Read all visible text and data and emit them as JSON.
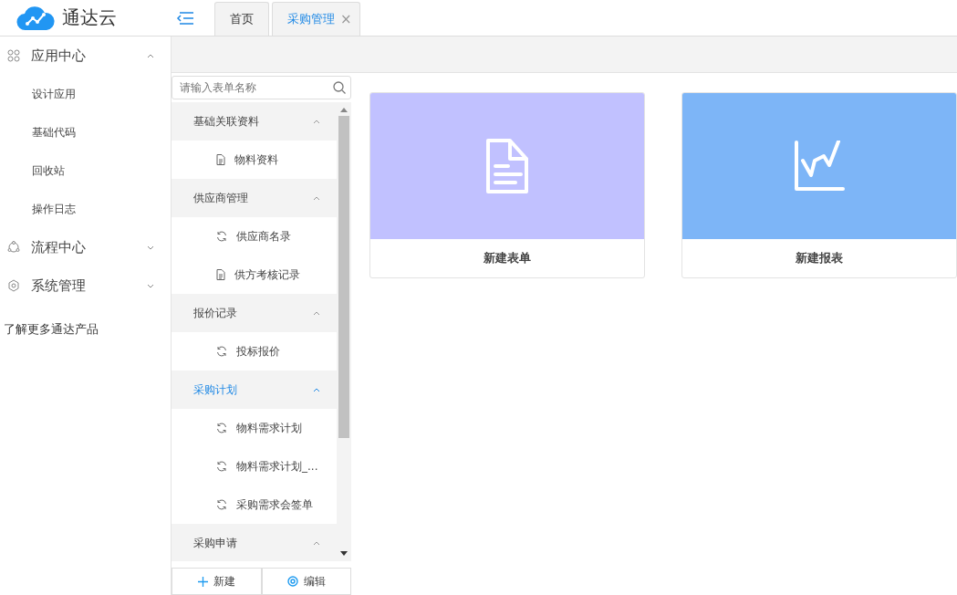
{
  "logo": {
    "text": "通达云"
  },
  "tabs": [
    {
      "label": "首页",
      "selected": false
    },
    {
      "label": "采购管理",
      "selected": true,
      "close": "×"
    }
  ],
  "sidebar": {
    "items": [
      {
        "label": "应用中心",
        "kind": "apps",
        "expanded": true,
        "children": [
          {
            "label": "设计应用"
          },
          {
            "label": "基础代码"
          },
          {
            "label": "回收站"
          },
          {
            "label": "操作日志"
          }
        ]
      },
      {
        "label": "流程中心",
        "kind": "flow",
        "expanded": false
      },
      {
        "label": "系统管理",
        "kind": "gear",
        "expanded": false
      }
    ],
    "footer_link": "了解更多通达产品"
  },
  "form_list": {
    "search": {
      "placeholder": "请输入表单名称"
    },
    "groups": [
      {
        "label": "基础关联资料",
        "expanded": true,
        "selected": false,
        "children": [
          {
            "label": "物料资料",
            "kind": "form"
          }
        ]
      },
      {
        "label": "供应商管理",
        "expanded": true,
        "selected": false,
        "children": [
          {
            "label": "供应商名录",
            "kind": "flow"
          },
          {
            "label": "供方考核记录",
            "kind": "form"
          }
        ]
      },
      {
        "label": "报价记录",
        "expanded": true,
        "selected": false,
        "children": [
          {
            "label": "投标报价",
            "kind": "flow"
          }
        ]
      },
      {
        "label": "采购计划",
        "expanded": true,
        "selected": true,
        "children": [
          {
            "label": "物料需求计划",
            "kind": "flow"
          },
          {
            "label": "物料需求计划_...",
            "kind": "flow"
          },
          {
            "label": "采购需求会签单",
            "kind": "flow"
          }
        ]
      },
      {
        "label": "采购申请",
        "expanded": true,
        "selected": false
      }
    ],
    "buttons": [
      {
        "label": "新建",
        "kind": "add"
      },
      {
        "label": "编辑",
        "kind": "edit"
      }
    ]
  },
  "cards": [
    {
      "label": "新建表单",
      "kind": "form",
      "color": "#c1c1ff"
    },
    {
      "label": "新建报表",
      "kind": "report",
      "color": "#7db5f7"
    }
  ]
}
